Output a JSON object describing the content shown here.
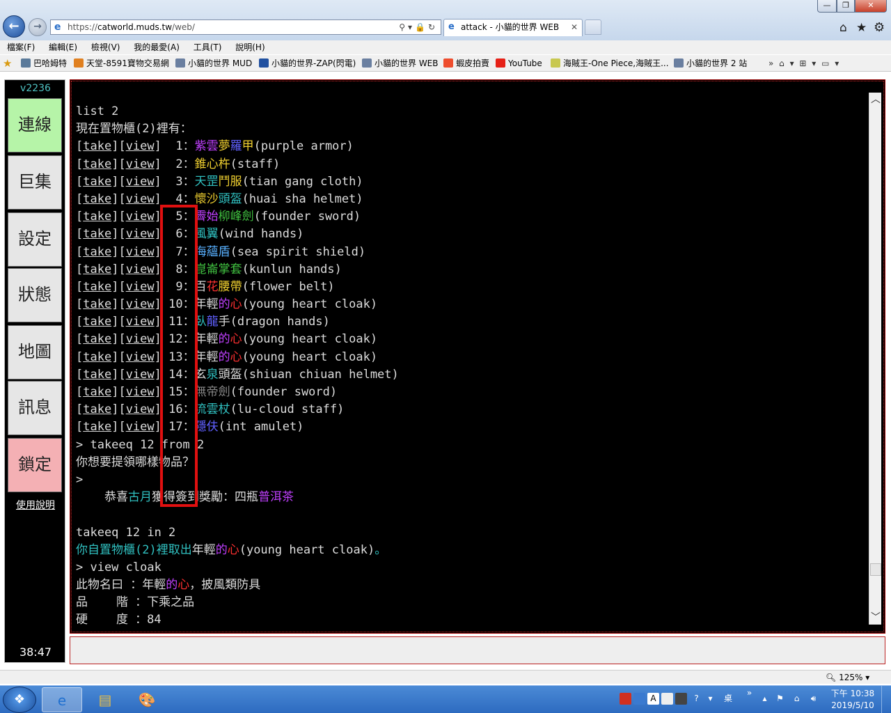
{
  "browser": {
    "url_scheme": "https://",
    "url_host": "catworld.muds.tw",
    "url_path": "/web/",
    "tab_title": "attack - 小貓的世界 WEB",
    "zoom": "125%",
    "window_controls": {
      "min": "—",
      "max": "❐",
      "close": "✕"
    },
    "address_icons": "⚲▾🔒↻",
    "tab_close": "✕"
  },
  "menu": [
    "檔案(F)",
    "編輯(E)",
    "檢視(V)",
    "我的最愛(A)",
    "工具(T)",
    "說明(H)"
  ],
  "favorites": [
    {
      "label": "巴哈姆特",
      "icon": "bahamut-icon",
      "color": "#5a7a9a"
    },
    {
      "label": "天堂-8591寶物交易網",
      "icon": "8591-icon",
      "color": "#e08020"
    },
    {
      "label": "小貓的世界 MUD",
      "icon": "page-icon",
      "color": "#6a7fa0"
    },
    {
      "label": "小貓的世界-ZAP(閃電)",
      "icon": "zap-icon",
      "color": "#2050a0"
    },
    {
      "label": "小貓的世界 WEB",
      "icon": "page-icon",
      "color": "#6a7fa0"
    },
    {
      "label": "蝦皮拍賣",
      "icon": "shopee-icon",
      "color": "#ee4d2d"
    },
    {
      "label": "YouTube",
      "icon": "youtube-icon",
      "color": "#e62117"
    },
    {
      "label": "海賊王-One Piece,海賊王...",
      "icon": "onepiece-icon",
      "color": "#c8c850"
    },
    {
      "label": "小貓的世界 2 站",
      "icon": "page-icon",
      "color": "#6a7fa0"
    }
  ],
  "favbar_right": "»  ⌂ ▾  ⊞ ▾  ▭ ▾",
  "sidebar": {
    "version": "v2236",
    "buttons": [
      "連線",
      "巨集",
      "設定",
      "狀態",
      "地圖",
      "訊息",
      "鎖定"
    ],
    "help": "使用說明",
    "timer": "38:47"
  },
  "terminal": {
    "lines": [
      [
        {
          "t": "list 2",
          "c": "white"
        }
      ],
      [
        {
          "t": "現在置物櫃(2)裡有：",
          "c": "white"
        }
      ],
      [
        {
          "t": "[",
          "c": "white"
        },
        {
          "t": "take",
          "c": "white",
          "u": true
        },
        {
          "t": "][",
          "c": "white"
        },
        {
          "t": "view",
          "c": "white",
          "u": true
        },
        {
          "t": "]  1：",
          "c": "white"
        },
        {
          "t": "紫雲",
          "c": "purple"
        },
        {
          "t": "夢",
          "c": "yellow"
        },
        {
          "t": "羅",
          "c": "blue"
        },
        {
          "t": "甲",
          "c": "yellow"
        },
        {
          "t": "(purple armor)",
          "c": "white"
        }
      ],
      [
        {
          "t": "[",
          "c": "white"
        },
        {
          "t": "take",
          "c": "white",
          "u": true
        },
        {
          "t": "][",
          "c": "white"
        },
        {
          "t": "view",
          "c": "white",
          "u": true
        },
        {
          "t": "]  2：",
          "c": "white"
        },
        {
          "t": "錐心杵",
          "c": "yellow"
        },
        {
          "t": "(staff)",
          "c": "white"
        }
      ],
      [
        {
          "t": "[",
          "c": "white"
        },
        {
          "t": "take",
          "c": "white",
          "u": true
        },
        {
          "t": "][",
          "c": "white"
        },
        {
          "t": "view",
          "c": "white",
          "u": true
        },
        {
          "t": "]  3：",
          "c": "white"
        },
        {
          "t": "天罡",
          "c": "cyan"
        },
        {
          "t": "鬥服",
          "c": "yellow"
        },
        {
          "t": "(tian gang cloth)",
          "c": "white"
        }
      ],
      [
        {
          "t": "[",
          "c": "white"
        },
        {
          "t": "take",
          "c": "white",
          "u": true
        },
        {
          "t": "][",
          "c": "white"
        },
        {
          "t": "view",
          "c": "white",
          "u": true
        },
        {
          "t": "]  4：",
          "c": "white"
        },
        {
          "t": "懷沙",
          "c": "yellow"
        },
        {
          "t": "頭盔",
          "c": "cyan"
        },
        {
          "t": "(huai sha helmet)",
          "c": "white"
        }
      ],
      [
        {
          "t": "[",
          "c": "white"
        },
        {
          "t": "take",
          "c": "white",
          "u": true
        },
        {
          "t": "][",
          "c": "white"
        },
        {
          "t": "view",
          "c": "white",
          "u": true
        },
        {
          "t": "]  5：",
          "c": "white"
        },
        {
          "t": "霽始",
          "c": "purple"
        },
        {
          "t": "柳峰劍",
          "c": "green"
        },
        {
          "t": "(founder sword)",
          "c": "white"
        }
      ],
      [
        {
          "t": "[",
          "c": "white"
        },
        {
          "t": "take",
          "c": "white",
          "u": true
        },
        {
          "t": "][",
          "c": "white"
        },
        {
          "t": "view",
          "c": "white",
          "u": true
        },
        {
          "t": "]  6：",
          "c": "white"
        },
        {
          "t": "風翼",
          "c": "cyan"
        },
        {
          "t": "(wind hands)",
          "c": "white"
        }
      ],
      [
        {
          "t": "[",
          "c": "white"
        },
        {
          "t": "take",
          "c": "white",
          "u": true
        },
        {
          "t": "][",
          "c": "white"
        },
        {
          "t": "view",
          "c": "white",
          "u": true
        },
        {
          "t": "]  7：",
          "c": "white"
        },
        {
          "t": "海蘊盾",
          "c": "sky"
        },
        {
          "t": "(sea spirit shield)",
          "c": "white"
        }
      ],
      [
        {
          "t": "[",
          "c": "white"
        },
        {
          "t": "take",
          "c": "white",
          "u": true
        },
        {
          "t": "][",
          "c": "white"
        },
        {
          "t": "view",
          "c": "white",
          "u": true
        },
        {
          "t": "]  8：",
          "c": "white"
        },
        {
          "t": "崑崙掌套",
          "c": "green"
        },
        {
          "t": "(kunlun hands)",
          "c": "white"
        }
      ],
      [
        {
          "t": "[",
          "c": "white"
        },
        {
          "t": "take",
          "c": "white",
          "u": true
        },
        {
          "t": "][",
          "c": "white"
        },
        {
          "t": "view",
          "c": "white",
          "u": true
        },
        {
          "t": "]  9：",
          "c": "white"
        },
        {
          "t": "百",
          "c": "white"
        },
        {
          "t": "花",
          "c": "red"
        },
        {
          "t": "腰帶",
          "c": "yellow"
        },
        {
          "t": "(flower belt)",
          "c": "white"
        }
      ],
      [
        {
          "t": "[",
          "c": "white"
        },
        {
          "t": "take",
          "c": "white",
          "u": true
        },
        {
          "t": "][",
          "c": "white"
        },
        {
          "t": "view",
          "c": "white",
          "u": true
        },
        {
          "t": "] 10：",
          "c": "white"
        },
        {
          "t": "年輕",
          "c": "white"
        },
        {
          "t": "的",
          "c": "purple"
        },
        {
          "t": "心",
          "c": "red"
        },
        {
          "t": "(young heart cloak)",
          "c": "white"
        }
      ],
      [
        {
          "t": "[",
          "c": "white"
        },
        {
          "t": "take",
          "c": "white",
          "u": true
        },
        {
          "t": "][",
          "c": "white"
        },
        {
          "t": "view",
          "c": "white",
          "u": true
        },
        {
          "t": "] 11：",
          "c": "white"
        },
        {
          "t": "臥",
          "c": "cyan"
        },
        {
          "t": "龍",
          "c": "blue"
        },
        {
          "t": "手",
          "c": "white"
        },
        {
          "t": "(dragon hands)",
          "c": "white"
        }
      ],
      [
        {
          "t": "[",
          "c": "white"
        },
        {
          "t": "take",
          "c": "white",
          "u": true
        },
        {
          "t": "][",
          "c": "white"
        },
        {
          "t": "view",
          "c": "white",
          "u": true
        },
        {
          "t": "] 12：",
          "c": "white"
        },
        {
          "t": "年輕",
          "c": "white"
        },
        {
          "t": "的",
          "c": "purple"
        },
        {
          "t": "心",
          "c": "red"
        },
        {
          "t": "(young heart cloak)",
          "c": "white"
        }
      ],
      [
        {
          "t": "[",
          "c": "white"
        },
        {
          "t": "take",
          "c": "white",
          "u": true
        },
        {
          "t": "][",
          "c": "white"
        },
        {
          "t": "view",
          "c": "white",
          "u": true
        },
        {
          "t": "] 13：",
          "c": "white"
        },
        {
          "t": "年輕",
          "c": "white"
        },
        {
          "t": "的",
          "c": "purple"
        },
        {
          "t": "心",
          "c": "red"
        },
        {
          "t": "(young heart cloak)",
          "c": "white"
        }
      ],
      [
        {
          "t": "[",
          "c": "white"
        },
        {
          "t": "take",
          "c": "white",
          "u": true
        },
        {
          "t": "][",
          "c": "white"
        },
        {
          "t": "view",
          "c": "white",
          "u": true
        },
        {
          "t": "] 14：",
          "c": "white"
        },
        {
          "t": "玄",
          "c": "white"
        },
        {
          "t": "泉",
          "c": "cyan"
        },
        {
          "t": "頭盔",
          "c": "white"
        },
        {
          "t": "(shiuan chiuan helmet)",
          "c": "white"
        }
      ],
      [
        {
          "t": "[",
          "c": "white"
        },
        {
          "t": "take",
          "c": "white",
          "u": true
        },
        {
          "t": "][",
          "c": "white"
        },
        {
          "t": "view",
          "c": "white",
          "u": true
        },
        {
          "t": "] 15：",
          "c": "white"
        },
        {
          "t": "無帝劍",
          "c": "grey"
        },
        {
          "t": "(founder sword)",
          "c": "white"
        }
      ],
      [
        {
          "t": "[",
          "c": "white"
        },
        {
          "t": "take",
          "c": "white",
          "u": true
        },
        {
          "t": "][",
          "c": "white"
        },
        {
          "t": "view",
          "c": "white",
          "u": true
        },
        {
          "t": "] 16：",
          "c": "white"
        },
        {
          "t": "流雲杖",
          "c": "cyan"
        },
        {
          "t": "(lu-cloud staff)",
          "c": "white"
        }
      ],
      [
        {
          "t": "[",
          "c": "white"
        },
        {
          "t": "take",
          "c": "white",
          "u": true
        },
        {
          "t": "][",
          "c": "white"
        },
        {
          "t": "view",
          "c": "white",
          "u": true
        },
        {
          "t": "] 17：",
          "c": "white"
        },
        {
          "t": "隱伕",
          "c": "blue"
        },
        {
          "t": "(int amulet)",
          "c": "white"
        }
      ],
      [
        {
          "t": "> takeeq 12 from 2",
          "c": "white"
        }
      ],
      [
        {
          "t": "你想要提領哪樣物品？",
          "c": "white"
        }
      ],
      [
        {
          "t": ">",
          "c": "white"
        }
      ],
      [
        {
          "t": "    恭喜",
          "c": "white"
        },
        {
          "t": "古月",
          "c": "cyan"
        },
        {
          "t": "獲得簽到獎勵：四瓶",
          "c": "white"
        },
        {
          "t": "普洱茶",
          "c": "purple"
        }
      ],
      [
        {
          "t": "",
          "c": "white"
        }
      ],
      [
        {
          "t": "takeeq 12 in 2",
          "c": "white"
        }
      ],
      [
        {
          "t": "你自置物櫃(2)裡取出",
          "c": "cyan"
        },
        {
          "t": "年輕",
          "c": "white"
        },
        {
          "t": "的",
          "c": "purple"
        },
        {
          "t": "心",
          "c": "red"
        },
        {
          "t": "(young heart cloak)",
          "c": "white"
        },
        {
          "t": "。",
          "c": "cyan"
        }
      ],
      [
        {
          "t": "> view cloak",
          "c": "white"
        }
      ],
      [
        {
          "t": "此物名曰 ：",
          "c": "white"
        },
        {
          "t": "年輕",
          "c": "white"
        },
        {
          "t": "的",
          "c": "purple"
        },
        {
          "t": "心",
          "c": "red"
        },
        {
          "t": "，披風類防具",
          "c": "white"
        }
      ],
      [
        {
          "t": "品    階 ：下乘之品",
          "c": "white"
        }
      ],
      [
        {
          "t": "硬    度 ：84",
          "c": "white"
        }
      ]
    ],
    "scroll_up": "︿",
    "scroll_down": "﹀"
  },
  "taskbar": {
    "start": "❖",
    "apps": [
      {
        "icon": "internet-explorer-icon",
        "glyph": "e"
      },
      {
        "icon": "file-explorer-icon",
        "glyph": "▤"
      },
      {
        "icon": "paint-icon",
        "glyph": "🎨"
      }
    ],
    "desktop_label": "桌面",
    "tray_chevron": "»",
    "time": "下午 10:38",
    "date": "2019/5/10"
  },
  "colors": {
    "white": "#dddddd",
    "purple": "#c040ff",
    "yellow": "#f0d030",
    "cyan": "#30c0c0",
    "blue": "#6060ff",
    "green": "#40c040",
    "red": "#ff3030",
    "grey": "#888888",
    "sky": "#58b0ff"
  }
}
